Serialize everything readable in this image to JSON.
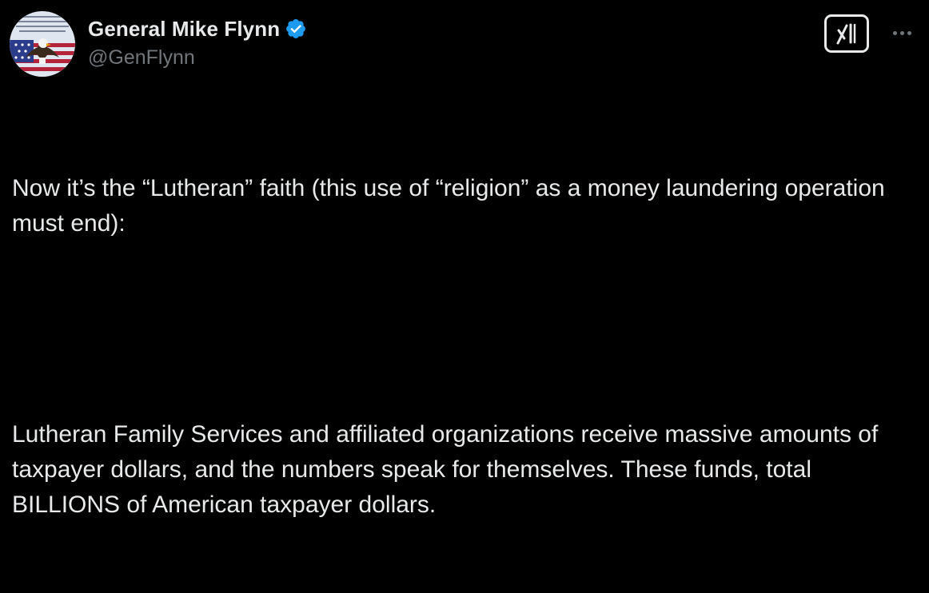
{
  "author": {
    "display_name": "General Mike Flynn",
    "handle": "@GenFlynn",
    "verified": true,
    "verified_color": "#1d9bf0",
    "avatar_icon": "bald-eagle-american-flag-avatar"
  },
  "actions": {
    "grok_icon": "grok-logo-icon",
    "more_icon": "more-horizontal-icon"
  },
  "tweet": {
    "paragraphs": [
      "Now it’s the “Lutheran” faith (this use of “religion” as a money laundering operation must end):",
      "Lutheran Family Services and affiliated organizations receive massive amounts of taxpayer dollars, and the numbers speak for themselves. These funds, total BILLIONS of American taxpayer dollars."
    ]
  },
  "colors": {
    "background": "#000000",
    "primary_text": "#e7e9ea",
    "secondary_text": "#71767b"
  }
}
